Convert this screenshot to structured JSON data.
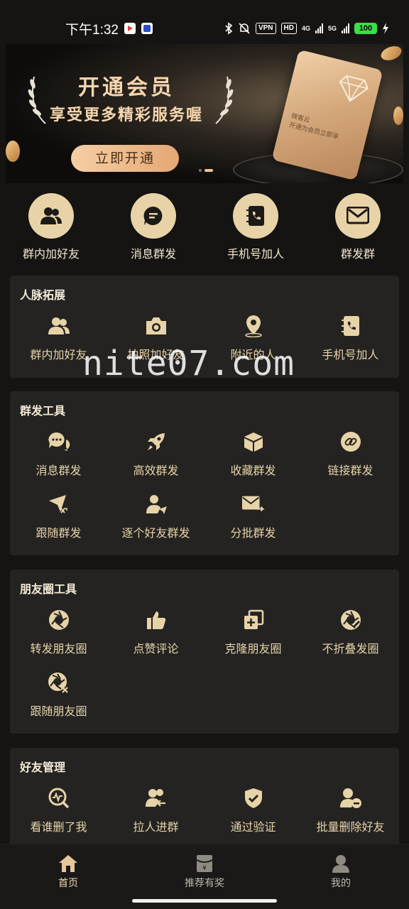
{
  "status_bar": {
    "time": "下午1:32",
    "vpn": "VPN",
    "hd": "HD",
    "net1": "4G",
    "net2": "5G",
    "battery": "100"
  },
  "banner": {
    "title": "开通会员",
    "subtitle": "享受更多精彩服务喔",
    "button": "立即开通",
    "card_text_1": "微客云",
    "card_text_2": "开通为会员立即享"
  },
  "quick_actions": [
    {
      "label": "群内加好友",
      "icon": "group-users-icon"
    },
    {
      "label": "消息群发",
      "icon": "chat-bubble-icon"
    },
    {
      "label": "手机号加人",
      "icon": "phone-book-icon"
    },
    {
      "label": "群发群",
      "icon": "mail-icon"
    }
  ],
  "sections": {
    "network": {
      "title": "人脉拓展",
      "items": [
        {
          "label": "群内加好友",
          "icon": "group-users-icon"
        },
        {
          "label": "拍照加好友",
          "icon": "camera-icon"
        },
        {
          "label": "附近的人",
          "icon": "location-pin-icon"
        },
        {
          "label": "手机号加人",
          "icon": "phone-book-icon"
        }
      ]
    },
    "broadcast": {
      "title": "群发工具",
      "items": [
        {
          "label": "消息群发",
          "icon": "chat-bubbles-icon"
        },
        {
          "label": "高效群发",
          "icon": "rocket-icon"
        },
        {
          "label": "收藏群发",
          "icon": "box-icon"
        },
        {
          "label": "链接群发",
          "icon": "link-icon"
        },
        {
          "label": "跟随群发",
          "icon": "send-shuffle-icon"
        },
        {
          "label": "逐个好友群发",
          "icon": "user-send-icon"
        },
        {
          "label": "分批群发",
          "icon": "mail-forward-icon"
        }
      ]
    },
    "moments": {
      "title": "朋友圈工具",
      "items": [
        {
          "label": "转发朋友圈",
          "icon": "aperture-icon"
        },
        {
          "label": "点赞评论",
          "icon": "thumbs-up-icon"
        },
        {
          "label": "克隆朋友圈",
          "icon": "clone-plus-icon"
        },
        {
          "label": "不折叠发圈",
          "icon": "aperture-edit-icon"
        },
        {
          "label": "跟随朋友圈",
          "icon": "aperture-shuffle-icon"
        }
      ]
    },
    "friends": {
      "title": "好友管理",
      "items": [
        {
          "label": "看谁删了我",
          "icon": "search-pulse-icon"
        },
        {
          "label": "拉人进群",
          "icon": "users-pull-icon"
        },
        {
          "label": "通过验证",
          "icon": "shield-check-icon"
        },
        {
          "label": "批量删除好友",
          "icon": "user-remove-icon"
        }
      ]
    }
  },
  "watermark": "nite07.com",
  "bottom_nav": [
    {
      "label": "首页",
      "icon": "home-icon",
      "active": true
    },
    {
      "label": "推荐有奖",
      "icon": "red-envelope-icon",
      "active": false
    },
    {
      "label": "我的",
      "icon": "profile-icon",
      "active": false
    }
  ],
  "colors": {
    "background": "#151412",
    "panel": "#242322",
    "accent_gold": "#e8d3a8",
    "label_gold": "#e6d3a7"
  }
}
